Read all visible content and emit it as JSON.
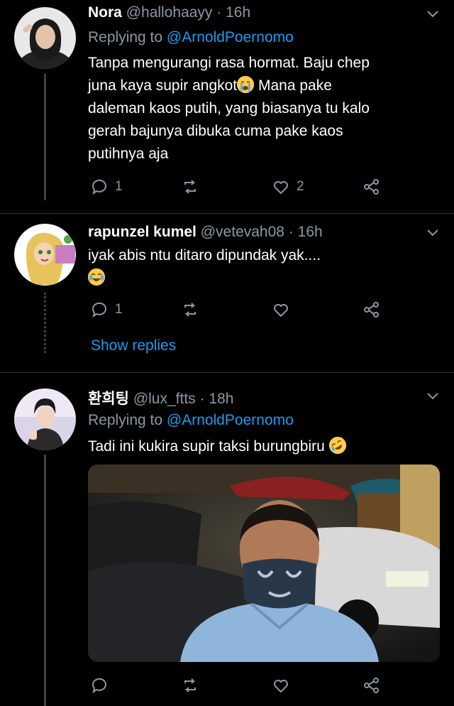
{
  "tweets": [
    {
      "name": "Nora",
      "handle": "@hallohaayy",
      "time": "· 16h",
      "replying_label": "Replying to",
      "replying_to": "@ArnoldPoernomo",
      "text_lines": [
        "Tanpa mengurangi rasa hormat. Baju chep",
        "juna kaya supir angkot",
        " Mana pake",
        "daleman kaos putih, yang biasanya tu kalo",
        "gerah bajunya dibuka cuma pake kaos",
        "putihnya aja"
      ],
      "reply_count": "1",
      "like_count": "2"
    },
    {
      "name": "rapunzel kumel",
      "handle": "@vetevah08",
      "time": "· 16h",
      "text": "iyak abis ntu ditaro dipundak yak....",
      "reply_count": "1",
      "show_replies": "Show replies"
    },
    {
      "name": "환희팅",
      "handle": "@lux_ftts",
      "time": "· 18h",
      "replying_label": "Replying to",
      "replying_to": "@ArnoldPoernomo",
      "text": "Tadi ini kukira supir taksi burungbiru"
    }
  ],
  "icons": {
    "reply": "reply-icon",
    "retweet": "retweet-icon",
    "like": "heart-icon",
    "share": "share-icon",
    "menu": "chevron-down-icon"
  },
  "colors": {
    "background": "#000000",
    "muted": "#8b98a5",
    "link": "#1d9bf0",
    "divider": "#2f3336"
  }
}
